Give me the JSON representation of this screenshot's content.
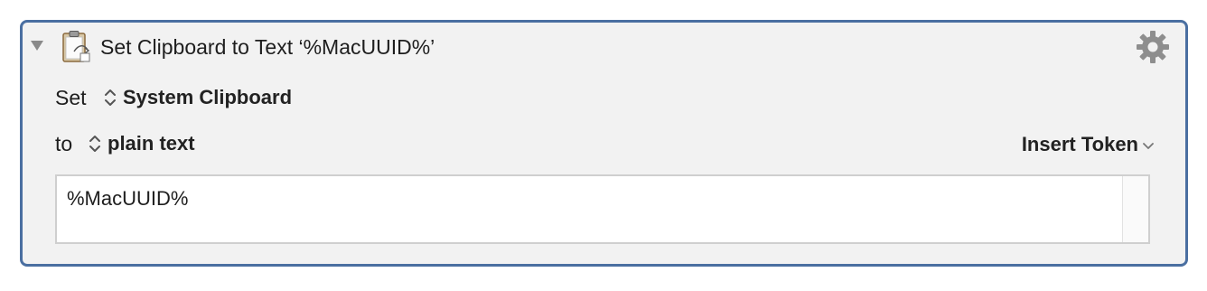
{
  "action": {
    "title": "Set Clipboard to Text ‘%MacUUID%’",
    "icon": "clipboard-icon",
    "settings_icon": "gear-icon",
    "disclosure_icon": "disclosure-triangle-icon"
  },
  "set_row": {
    "label": "Set",
    "popup_value": "System Clipboard"
  },
  "to_row": {
    "label": "to",
    "popup_value": "plain text",
    "insert_token_label": "Insert Token"
  },
  "text_field": {
    "value": "%MacUUID%"
  },
  "colors": {
    "panel_border": "#4a6fa1",
    "panel_background": "#f2f2f2",
    "icon_gray": "#8a8a8a"
  }
}
